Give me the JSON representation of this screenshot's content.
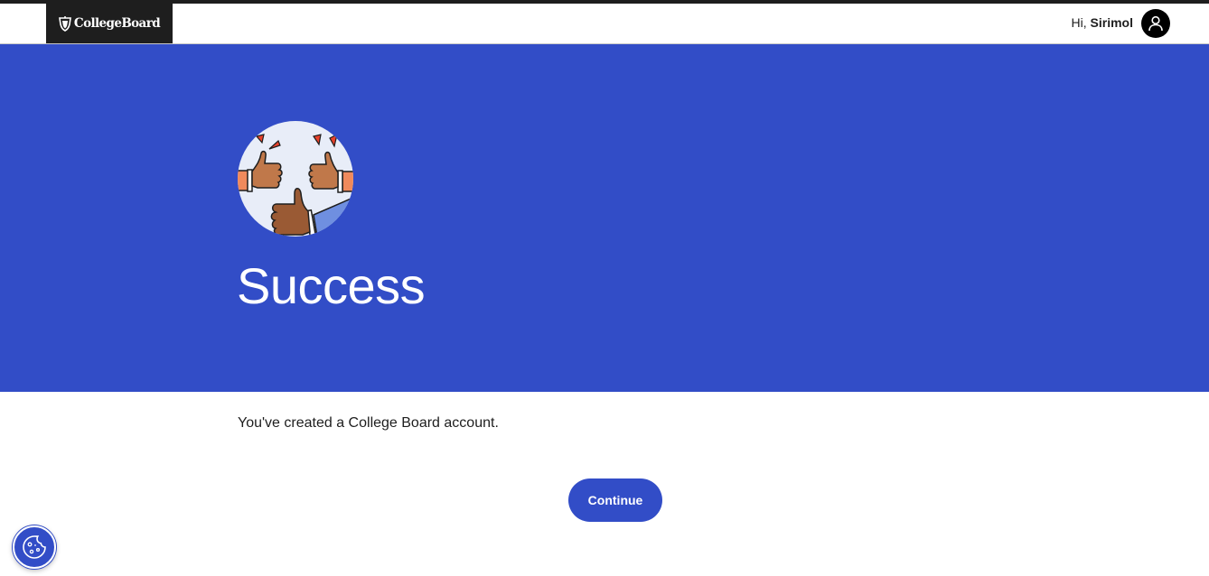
{
  "header": {
    "logo_text": "CollegeBoard",
    "greeting_prefix": "Hi, ",
    "user_name": "Sirimol"
  },
  "hero": {
    "title": "Success",
    "illustration_icon": "thumbs-up-illustration"
  },
  "main": {
    "message": "You've created a College Board account.",
    "continue_label": "Continue"
  },
  "cookie_settings": {
    "icon": "cookie-icon"
  },
  "colors": {
    "brand_blue": "#324dc7",
    "header_dark": "#1e1e1e",
    "text": "#1e1e1e",
    "white": "#ffffff"
  }
}
